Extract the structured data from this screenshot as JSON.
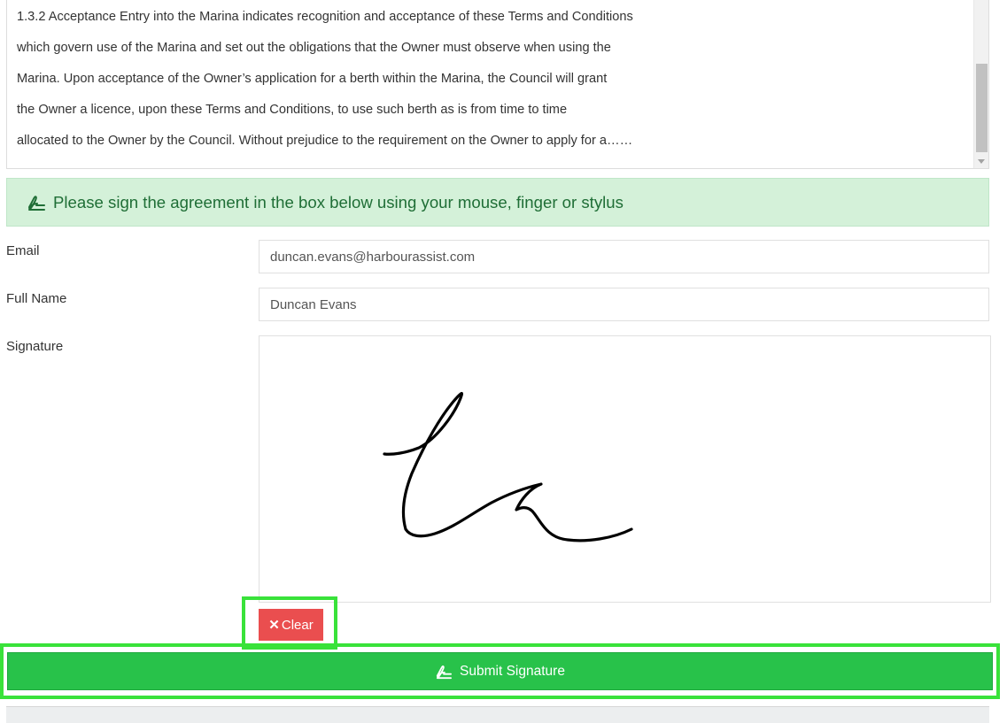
{
  "terms": {
    "lines": [
      "1.3.2 Acceptance Entry into the Marina indicates recognition and acceptance of these Terms and Conditions",
      "which govern use of the Marina and set out the obligations that the Owner must observe when using the",
      "Marina. Upon acceptance of the Owner’s application for a berth within the Marina, the Council will grant",
      "the Owner a licence, upon these Terms and Conditions, to use such berth as is from time to time",
      "allocated to the Owner by the Council. Without prejudice to the requirement on the Owner to apply for a……"
    ]
  },
  "notice": {
    "icon": "signature-icon",
    "text": "Please sign the agreement in the box below using your mouse, finger or stylus"
  },
  "form": {
    "email_label": "Email",
    "email_value": "duncan.evans@harbourassist.com",
    "name_label": "Full Name",
    "name_value": "Duncan Evans",
    "signature_label": "Signature"
  },
  "buttons": {
    "clear_icon": "close-icon",
    "clear_label": "Clear",
    "submit_icon": "signature-icon",
    "submit_label": "Submit Signature"
  },
  "colors": {
    "notice_bg": "#d4f1d9",
    "notice_text": "#1f6e36",
    "clear_bg": "#ea4e4f",
    "submit_bg": "#28c24a",
    "highlight": "#39e23a"
  }
}
